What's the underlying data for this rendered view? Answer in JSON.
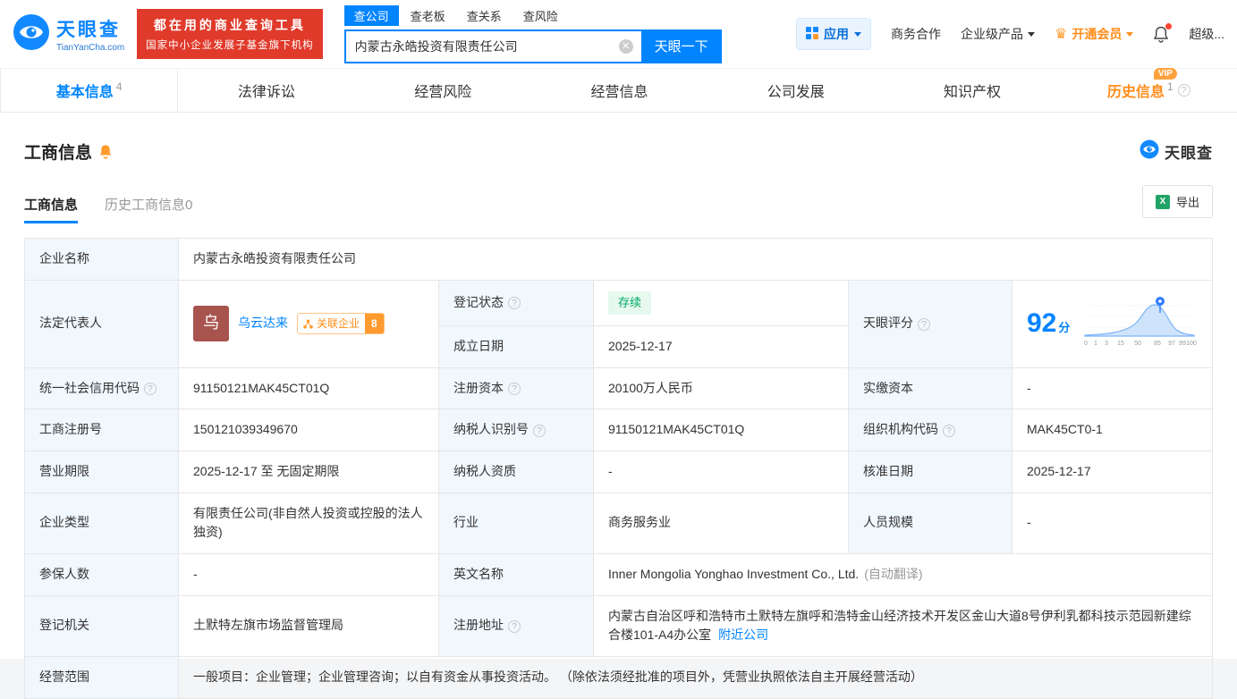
{
  "colors": {
    "accent": "#0084ff",
    "orange": "#ff8d1a",
    "red": "#e03a2b",
    "green": "#00a860"
  },
  "header": {
    "logo": {
      "title": "天眼查",
      "subtitle": "TianYanCha.com"
    },
    "promo": {
      "line1": "都在用的商业查询工具",
      "line2": "国家中小企业发展子基金旗下机构"
    },
    "search": {
      "tabs": [
        {
          "label": "查公司"
        },
        {
          "label": "查老板"
        },
        {
          "label": "查关系"
        },
        {
          "label": "查风险"
        }
      ],
      "value": "内蒙古永皓投资有限责任公司",
      "button": "天眼一下"
    },
    "nav": {
      "app": "应用",
      "cooperation": "商务合作",
      "enterprise": "企业级产品",
      "vip": "开通会员",
      "super": "超级..."
    }
  },
  "anchor_tabs": [
    {
      "label": "基本信息",
      "count": "4"
    },
    {
      "label": "法律诉讼"
    },
    {
      "label": "经营风险"
    },
    {
      "label": "经营信息"
    },
    {
      "label": "公司发展"
    },
    {
      "label": "知识产权"
    },
    {
      "label": "历史信息",
      "count": "1",
      "vip": "VIP"
    }
  ],
  "section": {
    "title": "工商信息",
    "brand": "天眼查",
    "subtabs": [
      {
        "label": "工商信息"
      },
      {
        "label": "历史工商信息0"
      }
    ],
    "export": "导出"
  },
  "info": {
    "company_name": {
      "label": "企业名称",
      "value": "内蒙古永皓投资有限责任公司"
    },
    "legal_rep": {
      "label": "法定代表人",
      "avatar_char": "乌",
      "name": "乌云达来",
      "related_label": "关联企业",
      "related_count": "8"
    },
    "status": {
      "label": "登记状态",
      "value": "存续"
    },
    "establish": {
      "label": "成立日期",
      "value": "2025-12-17"
    },
    "score": {
      "label": "天眼评分",
      "value": "92",
      "unit": "分",
      "ticks": [
        "0",
        "1",
        "3",
        "15",
        "50",
        "85",
        "97",
        "99",
        "100"
      ]
    },
    "credit_code": {
      "label": "统一社会信用代码",
      "value": "91150121MAK45CT01Q"
    },
    "reg_capital": {
      "label": "注册资本",
      "value": "20100万人民币"
    },
    "paid_capital": {
      "label": "实缴资本",
      "value": "-"
    },
    "reg_number": {
      "label": "工商注册号",
      "value": "150121039349670"
    },
    "taxpayer_id": {
      "label": "纳税人识别号",
      "value": "91150121MAK45CT01Q"
    },
    "org_code": {
      "label": "组织机构代码",
      "value": "MAK45CT0-1"
    },
    "business_term": {
      "label": "营业期限",
      "value": "2025-12-17 至 无固定期限"
    },
    "taxpayer_quali": {
      "label": "纳税人资质",
      "value": "-"
    },
    "approval_date": {
      "label": "核准日期",
      "value": "2025-12-17"
    },
    "company_type": {
      "label": "企业类型",
      "value": "有限责任公司(非自然人投资或控股的法人独资)"
    },
    "industry": {
      "label": "行业",
      "value": "商务服务业"
    },
    "staff_size": {
      "label": "人员规模",
      "value": "-"
    },
    "insured_count": {
      "label": "参保人数",
      "value": "-"
    },
    "english_name": {
      "label": "英文名称",
      "value": "Inner Mongolia Yonghao Investment Co., Ltd.",
      "note": "(自动翻译)"
    },
    "reg_authority": {
      "label": "登记机关",
      "value": "土默特左旗市场监督管理局"
    },
    "reg_address": {
      "label": "注册地址",
      "value": "内蒙古自治区呼和浩特市土默特左旗呼和浩特金山经济技术开发区金山大道8号伊利乳都科技示范园新建综合楼101-A4办公室",
      "link": "附近公司"
    },
    "business_scope": {
      "label": "经营范围",
      "value": "一般项目：企业管理；企业管理咨询；以自有资金从事投资活动。 （除依法须经批准的项目外，凭营业执照依法自主开展经营活动）"
    }
  }
}
